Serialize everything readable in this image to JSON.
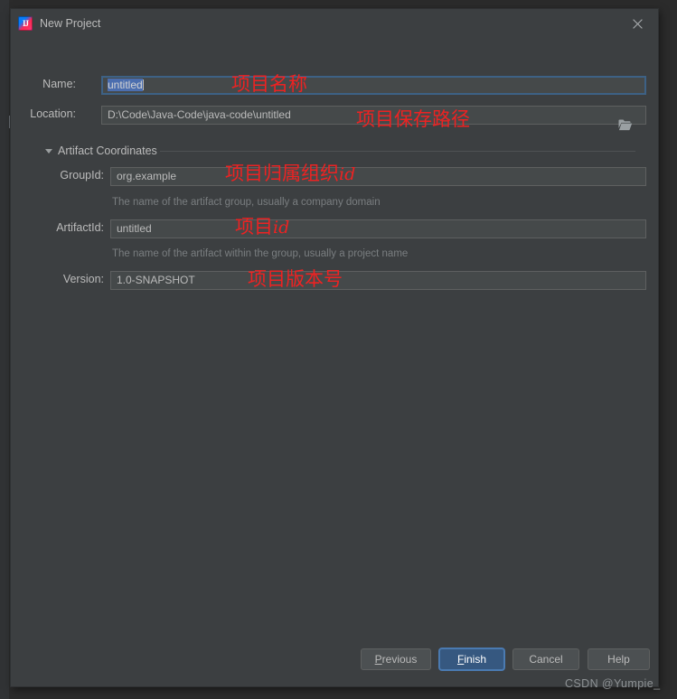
{
  "window": {
    "title": "New Project",
    "app_icon": "intellij-idea-icon",
    "close_icon": "close-icon"
  },
  "form": {
    "name": {
      "label": "Name:",
      "value": "untitled",
      "selected": true
    },
    "location": {
      "label": "Location:",
      "value": "D:\\Code\\Java-Code\\java-code\\untitled",
      "browse_icon": "folder-icon"
    },
    "group_section": {
      "label": "Artifact Coordinates",
      "expanded": true,
      "arrow_icon": "chevron-down-icon"
    },
    "group_id": {
      "label": "GroupId:",
      "value": "org.example",
      "hint": "The name of the artifact group, usually a company domain"
    },
    "artifact_id": {
      "label": "ArtifactId:",
      "value": "untitled",
      "hint": "The name of the artifact within the group, usually a project name"
    },
    "version": {
      "label": "Version:",
      "value": "1.0-SNAPSHOT"
    }
  },
  "annotations": [
    {
      "text": "项目名称",
      "en": ""
    },
    {
      "text": "项目保存路径",
      "en": ""
    },
    {
      "text": "项目归属组织",
      "en": "id"
    },
    {
      "text": "项目",
      "en": "id"
    },
    {
      "text": "项目版本号",
      "en": ""
    }
  ],
  "buttons": {
    "previous": {
      "mnemonic": "P",
      "rest": "revious"
    },
    "finish": {
      "mnemonic": "F",
      "rest": "inish"
    },
    "cancel": "Cancel",
    "help": "Help"
  },
  "watermark": "CSDN @Yumpie_",
  "colors": {
    "dialog_bg": "#3c3f41",
    "field_bg": "#45494a",
    "accent_blue": "#365880",
    "focus_border": "#3d6185",
    "selection_blue": "#4b6eaf",
    "annotation_red": "#ee2222",
    "text": "#bbbbbb",
    "hint_text": "#7a7e80"
  }
}
